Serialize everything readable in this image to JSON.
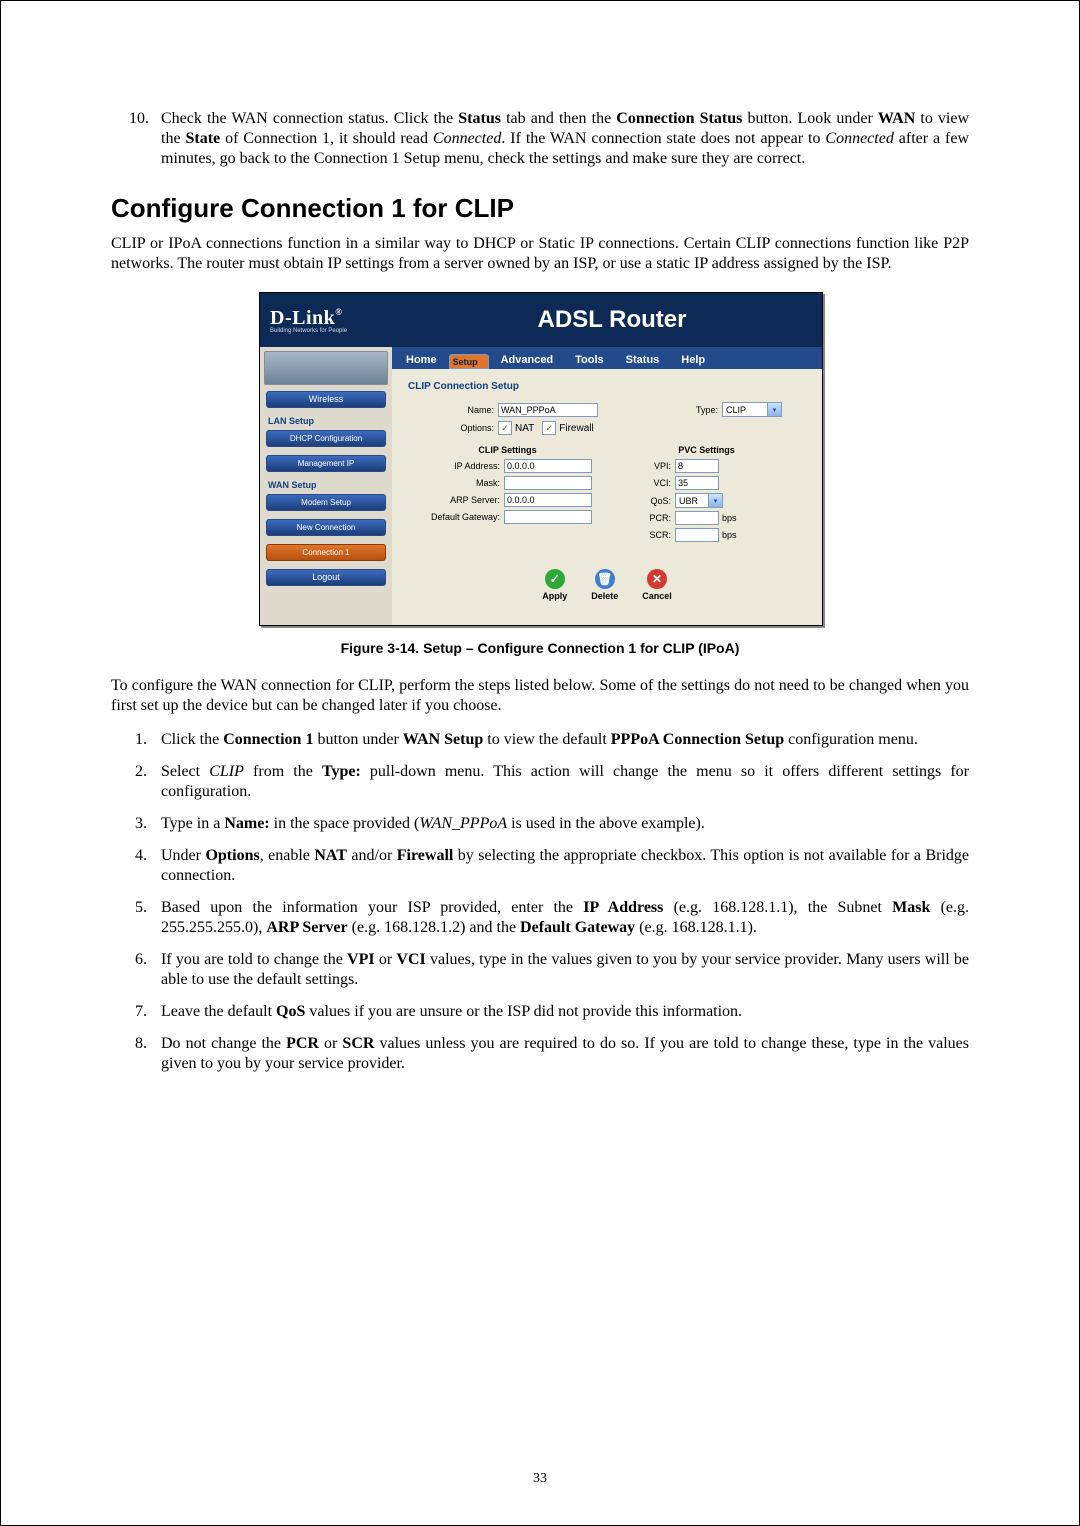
{
  "pageNumber": "33",
  "step10": {
    "num": "10",
    "text_before": "Check the WAN connection status. Click the ",
    "b1": "Status",
    "mid1": " tab and then the ",
    "b2": "Connection Status",
    "mid2": " button. Look under ",
    "b3": "WAN",
    "mid3": " to view the ",
    "b4": "State",
    "mid4": " of Connection 1, it should read ",
    "i1": "Connected",
    "mid5": ". If the WAN connection state does not appear to ",
    "i2": "Connected",
    "trail": " after a few minutes, go back to the Connection 1 Setup menu, check the settings and make sure they are correct."
  },
  "heading": "Configure Connection 1 for CLIP",
  "intro": "CLIP or IPoA connections function in a similar way to DHCP or Static IP connections. Certain CLIP connections function like P2P networks. The router must obtain IP settings from a server owned by an ISP, or use a static IP address assigned by the ISP.",
  "shot": {
    "logo": "D-Link",
    "logoDot": "®",
    "logoSub": "Building Networks for People",
    "title": "ADSL Router",
    "tabs": [
      "Home",
      "Setup",
      "Advanced",
      "Tools",
      "Status",
      "Help"
    ],
    "activeTab": 1,
    "side": {
      "wireless": "Wireless",
      "lan": "LAN Setup",
      "dhcp": "DHCP Configuration",
      "mgmt": "Management IP",
      "wan": "WAN Setup",
      "modem": "Modem Setup",
      "newconn": "New Connection",
      "conn1": "Connection 1",
      "logout": "Logout"
    },
    "panelTitle": "CLIP Connection Setup",
    "nameLabel": "Name:",
    "nameValue": "WAN_PPPoA",
    "typeLabel": "Type:",
    "typeValue": "CLIP",
    "optionsLabel": "Options:",
    "optNat": "NAT",
    "optFw": "Firewall",
    "left": {
      "title": "CLIP Settings",
      "ip_l": "IP Address:",
      "ip_v": "0.0.0.0",
      "mask_l": "Mask:",
      "mask_v": "",
      "arp_l": "ARP Server:",
      "arp_v": "0.0.0.0",
      "gw_l": "Default Gateway:",
      "gw_v": ""
    },
    "right": {
      "title": "PVC Settings",
      "vpi_l": "VPI:",
      "vpi_v": "8",
      "vci_l": "VCI:",
      "vci_v": "35",
      "qos_l": "QoS:",
      "qos_v": "UBR",
      "pcr_l": "PCR:",
      "pcr_v": "",
      "pcr_u": "bps",
      "scr_l": "SCR:",
      "scr_v": "",
      "scr_u": "bps"
    },
    "actions": {
      "apply": "Apply",
      "delete": "Delete",
      "cancel": "Cancel"
    }
  },
  "figcap": "Figure 3-14. Setup – Configure Connection 1 for CLIP (IPoA)",
  "lead": "To configure the WAN connection for CLIP, perform the steps listed below. Some of the settings do not need to be changed when you first set up the device but can be changed later if you choose.",
  "steps": {
    "s1": {
      "a": "Click the ",
      "b1": "Connection 1",
      "b": " button under ",
      "b2": "WAN Setup",
      "c": " to view the default ",
      "b3": "PPPoA Connection Setup",
      "d": " configuration menu."
    },
    "s2": {
      "a": "Select ",
      "i1": "CLIP",
      "b": " from the ",
      "b1": "Type:",
      "c": " pull-down menu. This action will change the menu so it offers different settings for configuration."
    },
    "s3": {
      "a": "Type in a ",
      "b1": "Name:",
      "b": " in the space provided (",
      "i1": "WAN_PPPoA",
      "c": " is used in the above example)."
    },
    "s4": {
      "a": "Under ",
      "b1": "Options",
      "b": ", enable ",
      "b2": "NAT",
      "c": " and/or ",
      "b3": "Firewall",
      "d": " by selecting the appropriate checkbox. This option is not available for a Bridge connection."
    },
    "s5": {
      "a": "Based upon the information your ISP provided, enter the ",
      "b1": "IP Address",
      "b": " (e.g. 168.128.1.1), the Subnet ",
      "b2": "Mask",
      "c": " (e.g. 255.255.255.0), ",
      "b3": "ARP Server",
      "d": " (e.g. 168.128.1.2) and the ",
      "b4": "Default Gateway",
      "e": " (e.g. 168.128.1.1)."
    },
    "s6": {
      "a": "If you are told to change the ",
      "b1": "VPI",
      "b": " or ",
      "b2": "VCI",
      "c": " values, type in the values given to you by your service provider. Many users will be able to use the default settings."
    },
    "s7": {
      "a": "Leave the default ",
      "b1": "QoS",
      "b": " values if you are unsure or the ISP did not provide this information."
    },
    "s8": {
      "a": "Do not change the ",
      "b1": "PCR",
      "b": " or ",
      "b2": "SCR",
      "c": " values unless you are required to do so. If you are told to change these, type in the values given to you by your service provider."
    }
  }
}
